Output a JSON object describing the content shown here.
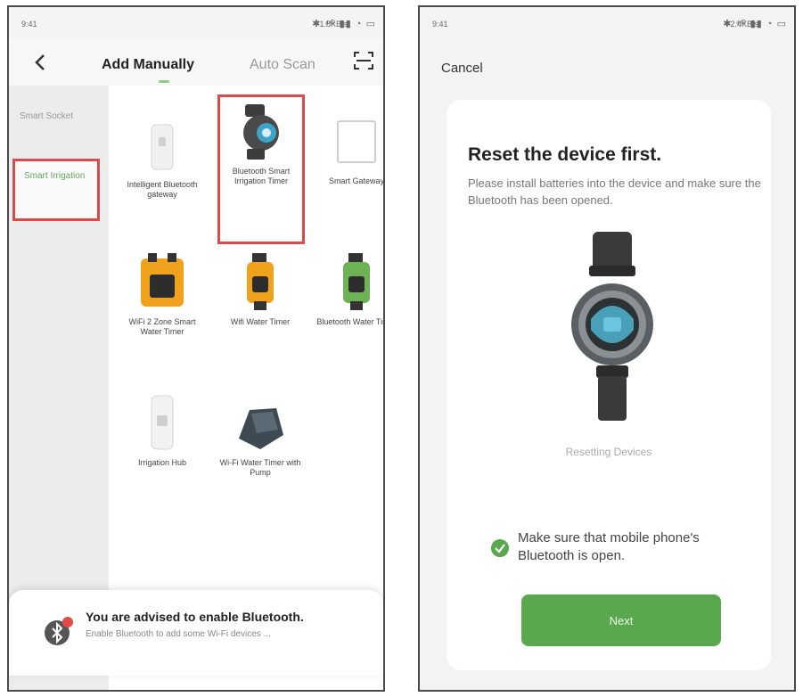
{
  "left_screen": {
    "status_bar": {
      "time": "9:41",
      "network": "1.8KB/s",
      "icons": "✱ ⁴ᴳ ▮▮ ◔ ▭"
    },
    "header": {
      "back_icon": "chevron-left-icon",
      "tab_manual": "Add Manually",
      "tab_auto": "Auto Scan",
      "scan_icon": "scan-icon"
    },
    "sidebar": {
      "items": [
        {
          "label": "Smart Socket",
          "selected": false
        },
        {
          "label": "Smart Irrigation",
          "selected": true
        }
      ]
    },
    "devices": [
      {
        "label": "Intelligent Bluetooth gateway"
      },
      {
        "label": "Bluetooth Smart Irrigation Timer",
        "highlighted": true
      },
      {
        "label": "Smart Gateway"
      },
      {
        "label": "WiFi 2 Zone Smart Water Timer"
      },
      {
        "label": "Wifi Water Timer"
      },
      {
        "label": "Bluetooth Water Timer"
      },
      {
        "label": "Irrigation Hub"
      },
      {
        "label": "Wi-Fi Water Timer with Pump"
      }
    ],
    "toast": {
      "icon": "bluetooth-icon",
      "title": "You are advised to enable Bluetooth.",
      "subtitle": "Enable Bluetooth to add some Wi-Fi devices ..."
    }
  },
  "right_screen": {
    "status_bar": {
      "time": "9:41",
      "network": "2.4KB/s",
      "icons": "✱ ⁴ᴳ ▮▮ ◔ ▭"
    },
    "cancel": "Cancel",
    "title": "Reset the device first.",
    "description": "Please install batteries into the device and make sure the Bluetooth has been opened.",
    "resetting": "Resetting Devices",
    "checkbox": {
      "checked": true,
      "label": "Make sure that mobile phone's Bluetooth is open."
    },
    "next_button": "Next"
  },
  "colors": {
    "accent_green": "#5aa84d",
    "highlight_red": "#d94a4a",
    "irrigation_green": "#62a85a"
  }
}
